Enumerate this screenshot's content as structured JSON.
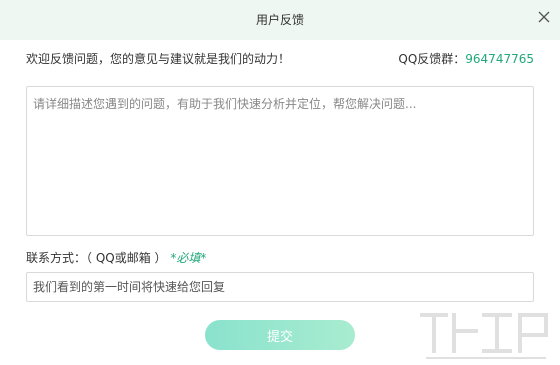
{
  "window": {
    "title": "用户反馈",
    "close_icon": "close-icon"
  },
  "intro": {
    "text": "欢迎反馈问题，您的意见与建议就是我们的动力！",
    "qq_group_label": "QQ反馈群：",
    "qq_group_number": "964747765"
  },
  "feedback": {
    "placeholder": "请详细描述您遇到的问题，有助于我们快速分析并定位，帮您解决问题...",
    "value": ""
  },
  "contact": {
    "label": "联系方式：（ QQ或邮箱 ）",
    "required_tag": "*必填*",
    "placeholder": "我们看到的第一时间将快速给您回复"
  },
  "submit": {
    "label": "提交"
  },
  "colors": {
    "accent": "#21a87a",
    "titlebar_bg": "#eef7f1",
    "button_gradient_start": "#8ae2cd",
    "button_gradient_end": "#a8ecd0"
  }
}
